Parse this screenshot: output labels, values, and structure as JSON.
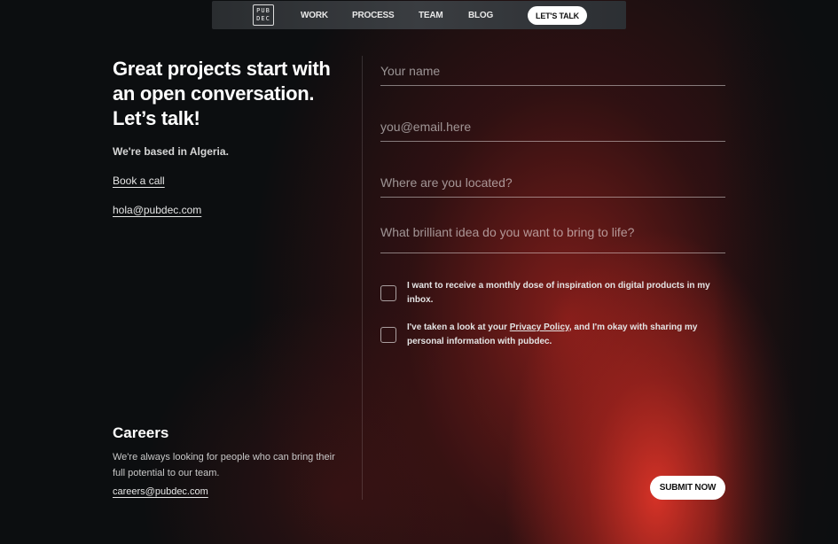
{
  "nav": {
    "logo_text": "PUB DEC",
    "items": [
      {
        "label": "WORK"
      },
      {
        "label": "PROCESS"
      },
      {
        "label": "TEAM"
      },
      {
        "label": "BLOG"
      }
    ],
    "cta_label": "LET'S TALK"
  },
  "intro": {
    "heading": "Great projects start with\nan open conversation.\nLet’s talk!",
    "based": "We're based in Algeria.",
    "book_call": "Book a call",
    "email": "hola@pubdec.com"
  },
  "form": {
    "name_placeholder": "Your name",
    "email_placeholder": "you@email.here",
    "location_placeholder": "Where are you located?",
    "idea_placeholder": "What brilliant idea do you want to bring to life?",
    "newsletter_label": "I want to receive a monthly dose of inspiration on digital products in my inbox.",
    "privacy_before": "I've taken a look at your ",
    "privacy_link": "Privacy Policy",
    "privacy_after": ", and I'm okay with sharing my personal information with pubdec.",
    "submit_label": "SUBMIT NOW"
  },
  "careers": {
    "title": "Careers",
    "text": "We're always looking for people who can bring their full potential to our team.",
    "email": "careers@pubdec.com"
  },
  "colors": {
    "background": "#0c0e10",
    "accent_glow": "#de3428"
  }
}
